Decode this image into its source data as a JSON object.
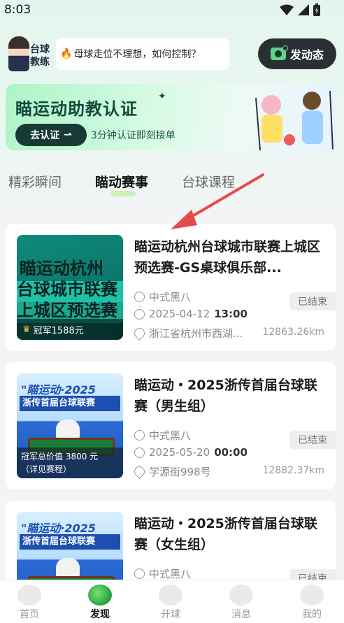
{
  "status_bar": {
    "time": "8:03"
  },
  "header": {
    "assistant_label": "台球教练",
    "question": "母球走位不理想，如何控制？",
    "post_button": "发动态"
  },
  "banner": {
    "title": "瞄运动助教认证",
    "button": "去认证",
    "subtitle": "3分钟认证即刻接单"
  },
  "tabs": [
    {
      "label": "精彩瞬间"
    },
    {
      "label": "瞄动赛事"
    },
    {
      "label": "台球课程"
    }
  ],
  "events": [
    {
      "title": "瞄运动杭州台球城市联赛上城区预选赛-GS桌球俱乐部...",
      "thumb_lines": [
        "瞄运动杭州",
        "台球城市联赛",
        "上城区预选赛"
      ],
      "prize": "冠军1588元",
      "game": "中式黑八",
      "date": "2025-04-12",
      "time": "13:00",
      "location": "浙江省杭州市西湖...",
      "distance": "12863.26km",
      "status": "已结束"
    },
    {
      "title": "瞄运动・2025浙传首届台球联赛（男生组）",
      "thumb_title": "\"瞄运动·2025",
      "thumb_sub": "浙传首届台球联赛",
      "prize": "冠军总价值 3800 元",
      "prize_more": "（详见赛程）",
      "game": "中式黑八",
      "date": "2025-05-20",
      "time": "00:00",
      "location": "学源街998号",
      "distance": "12882.37km",
      "status": "已结束"
    },
    {
      "title": "瞄运动・2025浙传首届台球联赛（女生组）",
      "thumb_title": "\"瞄运动·2025",
      "thumb_sub": "浙传首届台球联赛",
      "game": "中式黑八",
      "status": "已结束"
    }
  ],
  "bottom_nav": [
    {
      "label": "首页"
    },
    {
      "label": "发现"
    },
    {
      "label": "开球"
    },
    {
      "label": "消息"
    },
    {
      "label": "我的"
    }
  ],
  "colors": {
    "accent": "#22a23c",
    "banner_text": "#0f4a3c",
    "arrow": "#e84a4a"
  }
}
